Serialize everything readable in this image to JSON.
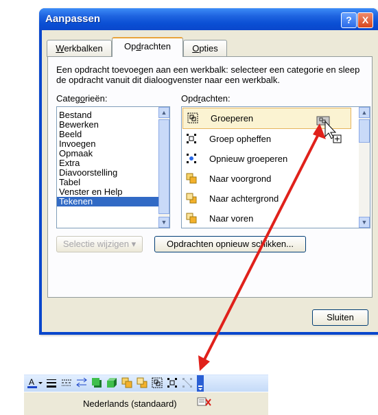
{
  "dialog": {
    "title": "Aanpassen",
    "help_button": "?",
    "close_button": "X",
    "tabs": [
      {
        "label_pre": "",
        "label_u": "W",
        "label_post": "erkbalken"
      },
      {
        "label_pre": "Op",
        "label_u": "d",
        "label_post": "rachten"
      },
      {
        "label_pre": "",
        "label_u": "O",
        "label_post": "pties"
      }
    ],
    "instruction": "Een opdracht toevoegen aan een werkbalk: selecteer een categorie en sleep de opdracht vanuit dit dialoogvenster naar een werkbalk.",
    "categories_label_pre": "Categ",
    "categories_label_u": "o",
    "categories_label_post": "rieën:",
    "commands_label_pre": "Opd",
    "commands_label_u": "r",
    "commands_label_post": "achten:",
    "categories": [
      "Bestand",
      "Bewerken",
      "Beeld",
      "Invoegen",
      "Opmaak",
      "Extra",
      "Diavoorstelling",
      "Tabel",
      "Venster en Help",
      "Tekenen"
    ],
    "selected_category": "Tekenen",
    "commands": [
      {
        "label": "Groeperen",
        "icon": "group-icon"
      },
      {
        "label": "Groep opheffen",
        "icon": "ungroup-icon"
      },
      {
        "label": "Opnieuw groeperen",
        "icon": "regroup-icon"
      },
      {
        "label": "Naar voorgrond",
        "icon": "bring-to-front-icon"
      },
      {
        "label": "Naar achtergrond",
        "icon": "send-to-back-icon"
      },
      {
        "label": "Naar voren",
        "icon": "bring-forward-icon"
      }
    ],
    "selected_command": "Groeperen",
    "modify_selection_button": "Selectie wijzigen ▾",
    "rearrange_button": "Opdrachten opnieuw schikken...",
    "close_label": "Sluiten"
  },
  "toolbar": {
    "icons": [
      "font-color-icon",
      "dropdown-arrow-icon",
      "line-style-icon",
      "dash-style-icon",
      "arrow-style-icon",
      "shadow-icon",
      "3d-icon",
      "bring-to-front-icon",
      "send-to-back-icon",
      "group-icon",
      "ungroup-icon",
      "regroup-icon",
      "toolbar-options-icon"
    ]
  },
  "statusbar": {
    "language": "Nederlands (standaard)"
  },
  "colors": {
    "titlebar": "#0a47cc",
    "selection": "#316ac5",
    "drag_arrow": "#e0211b",
    "command_hover": "#fbf3d2"
  }
}
